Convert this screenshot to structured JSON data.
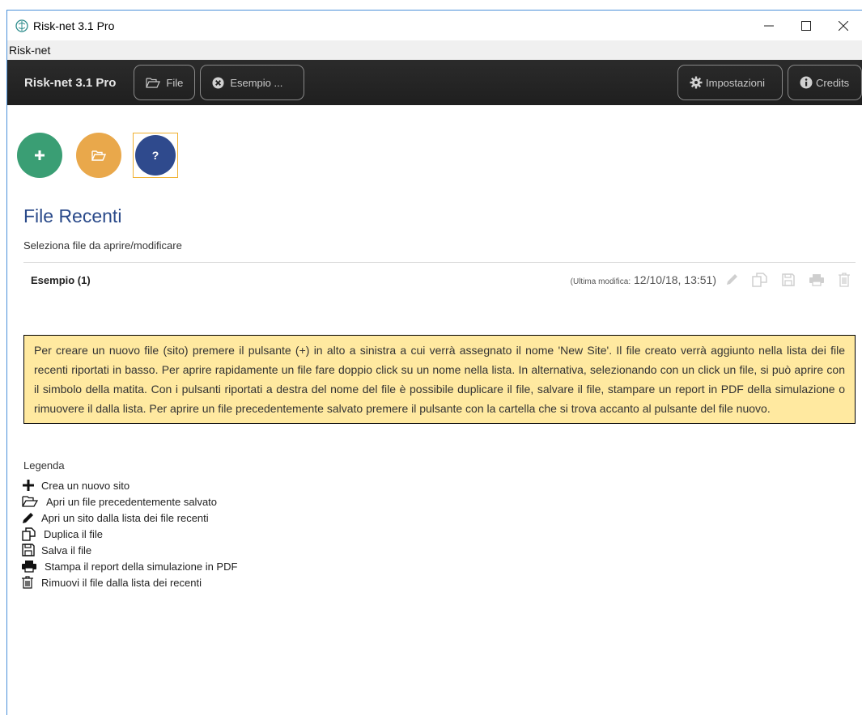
{
  "window": {
    "title": "Risk-net 3.1 Pro",
    "controls": {
      "minimize": "—",
      "maximize": "☐",
      "close": "✕"
    }
  },
  "menubar": {
    "label": "Risk-net"
  },
  "navbar": {
    "brand": "Risk-net 3.1 Pro",
    "file_label": "File",
    "example_label": "Esempio ...",
    "settings_label": "Impostazioni",
    "credits_label": "Credits"
  },
  "actions": {
    "new_icon": "plus-icon",
    "open_icon": "folder-open-icon",
    "help_label": "?",
    "colors": {
      "new": "#3a9e74",
      "open": "#e9a84b",
      "help": "#2f4a8d"
    }
  },
  "recent": {
    "title": "File Recenti",
    "subtitle": "Seleziona file da aprire/modificare",
    "files": [
      {
        "name": "Esempio (1)",
        "modified_label": "(Ultima modifica:",
        "modified_value": "12/10/18, 13:51)"
      }
    ]
  },
  "notice": {
    "text": "Per creare un nuovo file (sito) premere il pulsante (+) in alto a sinistra a cui verrà assegnato il nome 'New Site'. Il file creato verrà aggiunto nella lista dei file recenti riportati in basso. Per aprire rapidamente un file fare doppio click su un nome nella lista. In alternativa, selezionando con un click un file, si può aprire con il simbolo della matita. Con i pulsanti riportati a destra del nome del file è possibile duplicare il file, salvare il file, stampare un report in PDF della simulazione o rimuovere il dalla lista. Per aprire un file precedentemente salvato premere il pulsante con la cartella che si trova accanto al pulsante del file nuovo.",
    "background": "#ffe9a0"
  },
  "legend": {
    "title": "Legenda",
    "items": [
      {
        "icon": "plus-icon",
        "label": "Crea un nuovo sito"
      },
      {
        "icon": "folder-open-icon",
        "label": "Apri un file precedentemente salvato"
      },
      {
        "icon": "pencil-icon",
        "label": "Apri un sito dalla lista dei file recenti"
      },
      {
        "icon": "duplicate-icon",
        "label": "Duplica il file"
      },
      {
        "icon": "save-icon",
        "label": "Salva il file"
      },
      {
        "icon": "print-icon",
        "label": "Stampa il report della simulazione in PDF"
      },
      {
        "icon": "trash-icon",
        "label": "Rimuovi il file dalla lista dei recenti"
      }
    ]
  }
}
